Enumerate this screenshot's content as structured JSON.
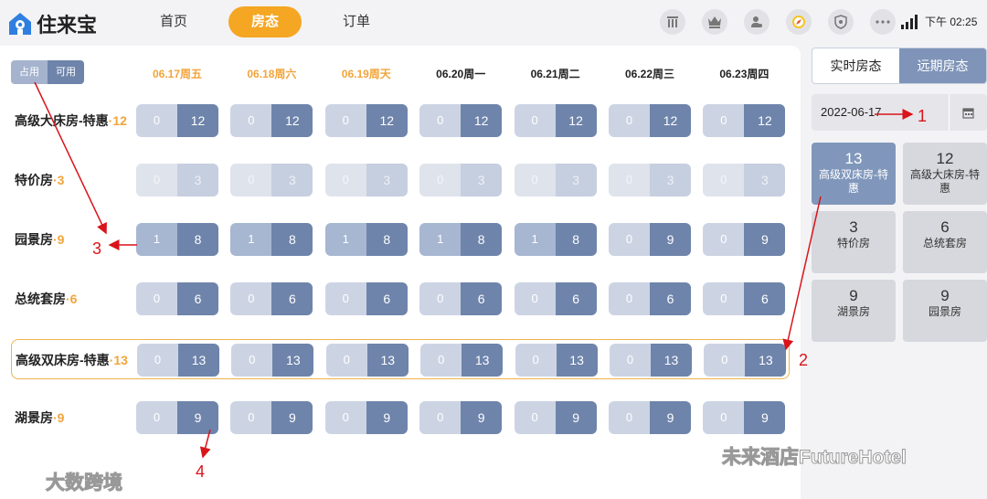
{
  "app": {
    "name": "住来宝"
  },
  "nav": [
    "首页",
    "房态",
    "订单"
  ],
  "status": {
    "time": "下午 02:25"
  },
  "legend": {
    "occupied": "占用",
    "available": "可用"
  },
  "dates": [
    "06.17周五",
    "06.18周六",
    "06.19周天",
    "06.20周一",
    "06.21周二",
    "06.22周三",
    "06.23周四"
  ],
  "weekend_flags": [
    true,
    true,
    true,
    false,
    false,
    false,
    false
  ],
  "rows": [
    {
      "name": "高级大床房-特惠",
      "sep": "·",
      "count": "12",
      "dim": false,
      "occ": [
        "0",
        "0",
        "0",
        "0",
        "0",
        "0",
        "0"
      ],
      "av": [
        "12",
        "12",
        "12",
        "12",
        "12",
        "12",
        "12"
      ]
    },
    {
      "name": "特价房",
      "sep": "·",
      "count": "3",
      "dim": true,
      "occ": [
        "0",
        "0",
        "0",
        "0",
        "0",
        "0",
        "0"
      ],
      "av": [
        "3",
        "3",
        "3",
        "3",
        "3",
        "3",
        "3"
      ]
    },
    {
      "name": "园景房",
      "sep": "·",
      "count": "9",
      "dim": false,
      "occ": [
        "1",
        "1",
        "1",
        "1",
        "1",
        "0",
        "0"
      ],
      "av": [
        "8",
        "8",
        "8",
        "8",
        "8",
        "9",
        "9"
      ]
    },
    {
      "name": "总统套房",
      "sep": "·",
      "count": "6",
      "dim": false,
      "occ": [
        "0",
        "0",
        "0",
        "0",
        "0",
        "0",
        "0"
      ],
      "av": [
        "6",
        "6",
        "6",
        "6",
        "6",
        "6",
        "6"
      ]
    },
    {
      "name": "高级双床房-特惠",
      "sep": "·",
      "count": "13",
      "dim": false,
      "highlight": true,
      "occ": [
        "0",
        "0",
        "0",
        "0",
        "0",
        "0",
        "0"
      ],
      "av": [
        "13",
        "13",
        "13",
        "13",
        "13",
        "13",
        "13"
      ]
    },
    {
      "name": "湖景房",
      "sep": "·",
      "count": "9",
      "dim": false,
      "occ": [
        "0",
        "0",
        "0",
        "0",
        "0",
        "0",
        "0"
      ],
      "av": [
        "9",
        "9",
        "9",
        "9",
        "9",
        "9",
        "9"
      ]
    }
  ],
  "right_panel": {
    "tabs": [
      "实时房态",
      "远期房态"
    ],
    "date": "2022-06-17",
    "tiles": [
      {
        "num": "13",
        "label": "高级双床房-特惠",
        "active": true
      },
      {
        "num": "12",
        "label": "高级大床房-特惠",
        "active": false
      },
      {
        "num": "3",
        "label": "特价房",
        "active": false
      },
      {
        "num": "6",
        "label": "总统套房",
        "active": false
      },
      {
        "num": "9",
        "label": "湖景房",
        "active": false
      },
      {
        "num": "9",
        "label": "园景房",
        "active": false
      }
    ]
  },
  "annotations": [
    "1",
    "2",
    "3",
    "4"
  ],
  "watermarks": {
    "left": "大数跨境",
    "right": "未来酒店FutureHotel"
  },
  "colors": {
    "accent": "#f5a623",
    "available": "#6e84ab",
    "occupied": "#a7b6d1",
    "annotation": "#d9141b"
  }
}
